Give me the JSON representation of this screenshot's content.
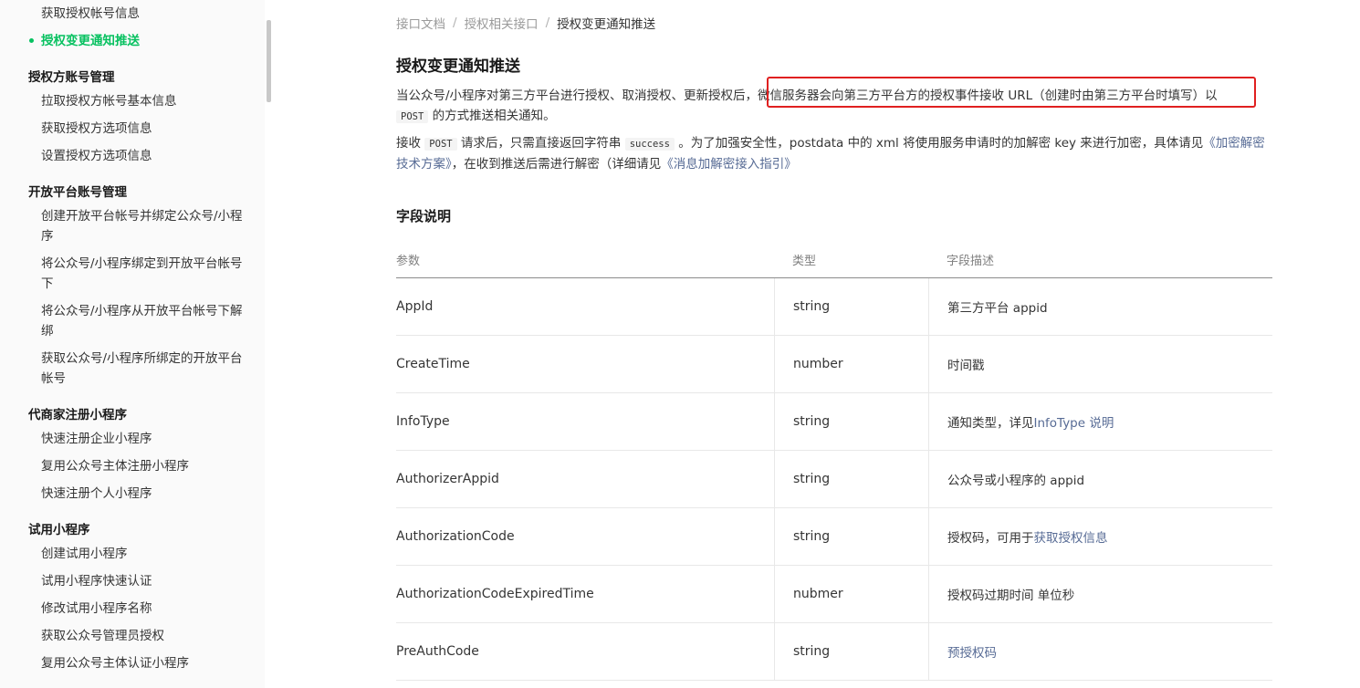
{
  "sidebar": {
    "top_item": "获取授权帐号信息",
    "active_item": "授权变更通知推送",
    "groups": [
      {
        "title": "授权方账号管理",
        "items": [
          "拉取授权方帐号基本信息",
          "获取授权方选项信息",
          "设置授权方选项信息"
        ]
      },
      {
        "title": "开放平台账号管理",
        "items": [
          "创建开放平台帐号并绑定公众号/小程序",
          "将公众号/小程序绑定到开放平台帐号下",
          "将公众号/小程序从开放平台帐号下解绑",
          "获取公众号/小程序所绑定的开放平台帐号"
        ]
      },
      {
        "title": "代商家注册小程序",
        "items": [
          "快速注册企业小程序",
          "复用公众号主体注册小程序",
          "快速注册个人小程序"
        ]
      },
      {
        "title": "试用小程序",
        "items": [
          "创建试用小程序",
          "试用小程序快速认证",
          "修改试用小程序名称",
          "获取公众号管理员授权",
          "复用公众号主体认证小程序"
        ]
      }
    ]
  },
  "breadcrumb": [
    "接口文档",
    "授权相关接口",
    "授权变更通知推送"
  ],
  "breadcrumb_sep": "/",
  "title": "授权变更通知推送",
  "para1": {
    "a": "当公众号/小程序对第三方平台进行授权、取消授权、更新授权后，",
    "b": "微信服务器会向第三方平台方的授权事件接收 URL（创建时由第三方平台时填写）以",
    "code": "POST",
    "c": " 的方式推送相关通知。"
  },
  "para2": {
    "a": "接收 ",
    "code1": "POST",
    "b": " 请求后，只需直接返回字符串 ",
    "code2": "success",
    "c": " 。为了加强安全性，postdata 中的 xml 将使用服务申请时的加解密 key 来进行加密，具体请见",
    "link1": "《加密解密技术方案》",
    "d": "，在收到推送后需进行解密（详细请见",
    "link2": "《消息加解密接入指引》",
    "e": ""
  },
  "section_title": "字段说明",
  "table": {
    "headers": [
      "参数",
      "类型",
      "字段描述"
    ],
    "rows": [
      {
        "param": "AppId",
        "type": "string",
        "desc": "第三方平台 appid",
        "link": ""
      },
      {
        "param": "CreateTime",
        "type": "number",
        "desc": "时间戳",
        "link": ""
      },
      {
        "param": "InfoType",
        "type": "string",
        "desc": "通知类型，详见",
        "link": "InfoType 说明"
      },
      {
        "param": "AuthorizerAppid",
        "type": "string",
        "desc": "公众号或小程序的 appid",
        "link": ""
      },
      {
        "param": "AuthorizationCode",
        "type": "string",
        "desc": "授权码，可用于",
        "link": "获取授权信息"
      },
      {
        "param": "AuthorizationCodeExpiredTime",
        "type": "nubmer",
        "desc": "授权码过期时间 单位秒",
        "link": ""
      },
      {
        "param": "PreAuthCode",
        "type": "string",
        "desc": "",
        "link": "预授权码"
      }
    ]
  },
  "colors": {
    "accent": "#07c160",
    "link": "#576b95",
    "highlight": "#e02020"
  }
}
